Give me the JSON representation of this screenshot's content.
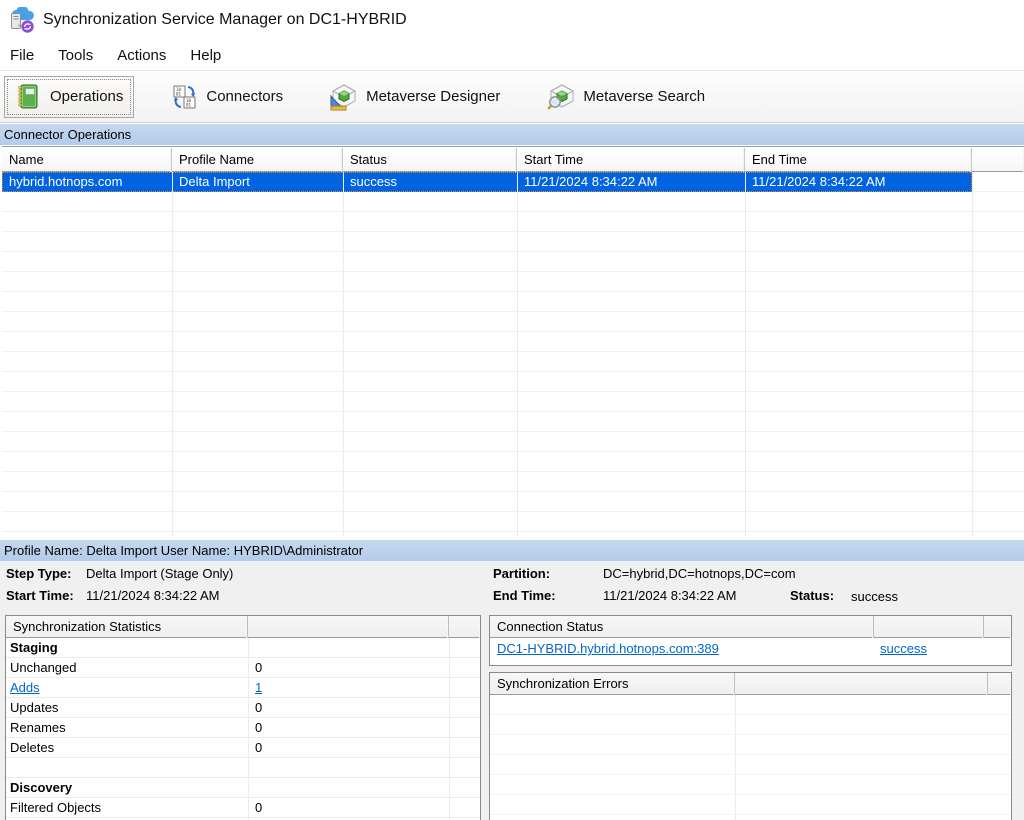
{
  "window": {
    "title": "Synchronization Service Manager on DC1-HYBRID"
  },
  "menu": {
    "items": [
      "File",
      "Tools",
      "Actions",
      "Help"
    ]
  },
  "toolbar": {
    "buttons": [
      {
        "label": "Operations",
        "icon": "operations-book-icon",
        "active": true
      },
      {
        "label": "Connectors",
        "icon": "connectors-icon",
        "active": false
      },
      {
        "label": "Metaverse Designer",
        "icon": "metaverse-designer-icon",
        "active": false
      },
      {
        "label": "Metaverse Search",
        "icon": "metaverse-search-icon",
        "active": false
      }
    ]
  },
  "operations_panel": {
    "title": "Connector Operations",
    "columns": [
      "Name",
      "Profile Name",
      "Status",
      "Start Time",
      "End Time",
      ""
    ],
    "rows": [
      {
        "name": "hybrid.hotnops.com",
        "profile_name": "Delta Import",
        "status": "success",
        "start_time": "11/21/2024 8:34:22 AM",
        "end_time": "11/21/2024 8:34:22 AM",
        "selected": true
      }
    ]
  },
  "detail": {
    "header": "Profile Name: Delta Import  User Name: HYBRID\\Administrator",
    "step_type_label": "Step Type:",
    "step_type": "Delta Import (Stage Only)",
    "start_time_label": "Start Time:",
    "start_time": "11/21/2024 8:34:22 AM",
    "partition_label": "Partition:",
    "partition": "DC=hybrid,DC=hotnops,DC=com",
    "end_time_label": "End Time:",
    "end_time": "11/21/2024 8:34:22 AM",
    "status_label": "Status:",
    "status": "success"
  },
  "sync_stats": {
    "title": "Synchronization Statistics",
    "rows": [
      {
        "label": "Staging",
        "value": "",
        "style": "bold"
      },
      {
        "label": "Unchanged",
        "value": "0",
        "style": ""
      },
      {
        "label": "Adds",
        "value": "1",
        "style": "link"
      },
      {
        "label": "Updates",
        "value": "0",
        "style": ""
      },
      {
        "label": "Renames",
        "value": "0",
        "style": ""
      },
      {
        "label": "Deletes",
        "value": "0",
        "style": ""
      },
      {
        "label": "",
        "value": "",
        "style": ""
      },
      {
        "label": "Discovery",
        "value": "",
        "style": "bold"
      },
      {
        "label": "Filtered Objects",
        "value": "0",
        "style": ""
      }
    ]
  },
  "connection_status": {
    "title": "Connection Status",
    "rows": [
      {
        "server": "DC1-HYBRID.hybrid.hotnops.com:389",
        "status": "success"
      }
    ]
  },
  "sync_errors": {
    "title": "Synchronization Errors"
  },
  "colors": {
    "selection_blue": "#0063e1",
    "section_bar_blue": "#b8d0ea",
    "link_blue": "#0066cc",
    "focus_dotted_orange": "#d98a3d"
  }
}
